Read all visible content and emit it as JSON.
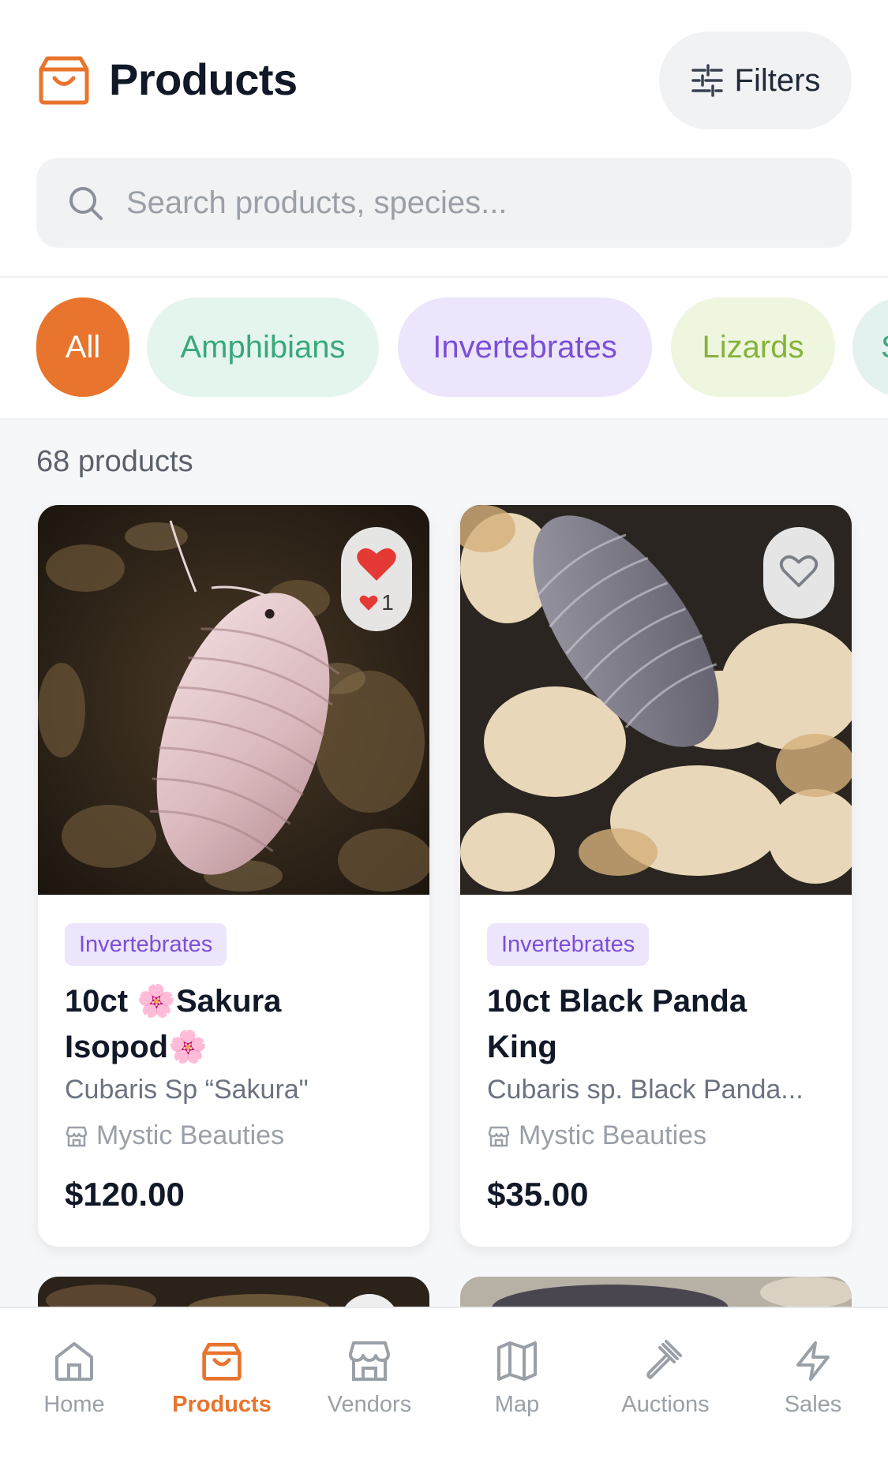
{
  "header": {
    "title": "Products",
    "filters_label": "Filters",
    "brand_color": "#e8742d"
  },
  "search": {
    "placeholder": "Search products, species..."
  },
  "categories": [
    {
      "label": "All",
      "active": true,
      "bg": "#e8742d",
      "fg": "#ffffff"
    },
    {
      "label": "Amphibians",
      "active": false,
      "bg": "#e4f5ee",
      "fg": "#3aa87a"
    },
    {
      "label": "Invertebrates",
      "active": false,
      "bg": "#ece5fc",
      "fg": "#7b4fd6"
    },
    {
      "label": "Lizards",
      "active": false,
      "bg": "#eef6df",
      "fg": "#86b23c"
    },
    {
      "label": "S",
      "active": false,
      "bg": "#e4f2ef",
      "fg": "#3aa87a"
    }
  ],
  "results": {
    "count_text": "68 products"
  },
  "products": [
    {
      "category": "Invertebrates",
      "title_line1": "10ct 🌸Sakura",
      "title_line2": "Isopod🌸",
      "subtitle": "Cubaris Sp “Sakura\"",
      "vendor": "Mystic Beauties",
      "price": "$120.00",
      "favorited": true,
      "fav_count": "1"
    },
    {
      "category": "Invertebrates",
      "title_line1": "10ct Black Panda",
      "title_line2": "King",
      "subtitle": "Cubaris sp. Black Panda...",
      "vendor": "Mystic Beauties",
      "price": "$35.00",
      "favorited": false
    }
  ],
  "nav": [
    {
      "label": "Home",
      "icon": "home-icon",
      "active": false
    },
    {
      "label": "Products",
      "icon": "shopping-bag-icon",
      "active": true
    },
    {
      "label": "Vendors",
      "icon": "store-icon",
      "active": false
    },
    {
      "label": "Map",
      "icon": "map-icon",
      "active": false
    },
    {
      "label": "Auctions",
      "icon": "gavel-icon",
      "active": false
    },
    {
      "label": "Sales",
      "icon": "bolt-icon",
      "active": false
    }
  ]
}
